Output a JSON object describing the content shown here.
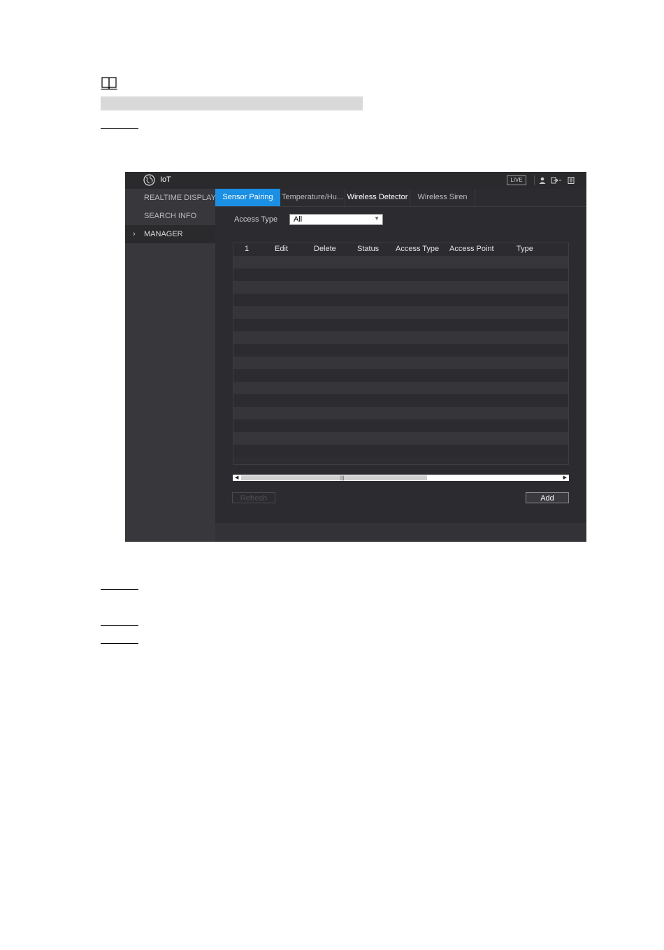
{
  "app": {
    "title": "IoT",
    "live_badge": "LIVE",
    "icons": [
      "globe-icon",
      "user-icon",
      "logout-icon",
      "menu-icon"
    ]
  },
  "sidebar": {
    "items": [
      {
        "label": "REALTIME DISPLAY"
      },
      {
        "label": "SEARCH INFO"
      },
      {
        "label": "MANAGER",
        "active": true
      }
    ],
    "chevron": "›"
  },
  "tabs": [
    {
      "label": "Sensor Pairing",
      "active": true
    },
    {
      "label": "Temperature/Hu..."
    },
    {
      "label": "Wireless Detector"
    },
    {
      "label": "Wireless Siren"
    }
  ],
  "filter": {
    "label": "Access Type",
    "value": "All"
  },
  "table": {
    "columns": [
      "1",
      "Edit",
      "Delete",
      "Status",
      "Access Type",
      "Access Point",
      "Type"
    ],
    "rows": []
  },
  "buttons": {
    "refresh": "Refresh",
    "add": "Add"
  },
  "colors": {
    "accent": "#1a8fe3",
    "background": "#2c2c30",
    "sidebar": "#38383c"
  }
}
